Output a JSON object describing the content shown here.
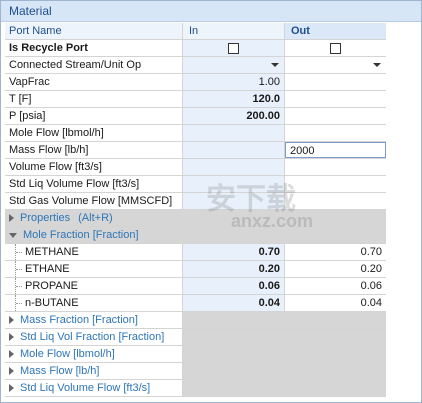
{
  "title": "Material",
  "columns": {
    "name": "Port Name",
    "in": "In",
    "out": "Out"
  },
  "rows": {
    "recycle": {
      "label": "Is Recycle Port"
    },
    "connected": {
      "label": "Connected Stream/Unit Op"
    },
    "vapfrac": {
      "label": "VapFrac",
      "in": "1.00",
      "out": ""
    },
    "t": {
      "label": "T [F]",
      "in": "120.0",
      "out": ""
    },
    "p": {
      "label": "P [psia]",
      "in": "200.00",
      "out": ""
    },
    "moleflow": {
      "label": "Mole Flow [lbmol/h]",
      "in": "",
      "out": ""
    },
    "massflow": {
      "label": "Mass Flow [lb/h]",
      "in": "",
      "out": "2000"
    },
    "volflow": {
      "label": "Volume Flow [ft3/s]",
      "in": "",
      "out": ""
    },
    "stdliq": {
      "label": "Std Liq Volume Flow [ft3/s]",
      "in": "",
      "out": ""
    },
    "stdgas": {
      "label": "Std Gas Volume Flow [MMSCFD]",
      "in": "",
      "out": ""
    }
  },
  "properties": {
    "label": "Properties",
    "hint": "(Alt+R)"
  },
  "mole_fraction": {
    "label": "Mole Fraction [Fraction]",
    "components": [
      {
        "name": "METHANE",
        "in": "0.70",
        "out": "0.70"
      },
      {
        "name": "ETHANE",
        "in": "0.20",
        "out": "0.20"
      },
      {
        "name": "PROPANE",
        "in": "0.06",
        "out": "0.06"
      },
      {
        "name": "n-BUTANE",
        "in": "0.04",
        "out": "0.04"
      }
    ]
  },
  "collapsed_groups": [
    {
      "label": "Mass Fraction [Fraction]"
    },
    {
      "label": "Std Liq Vol Fraction [Fraction]"
    },
    {
      "label": "Mole Flow [lbmol/h]"
    },
    {
      "label": "Mass Flow [lb/h]"
    },
    {
      "label": "Std Liq Volume Flow [ft3/s]"
    }
  ],
  "watermark": {
    "main": "安下载",
    "sub": "anxz.com"
  }
}
